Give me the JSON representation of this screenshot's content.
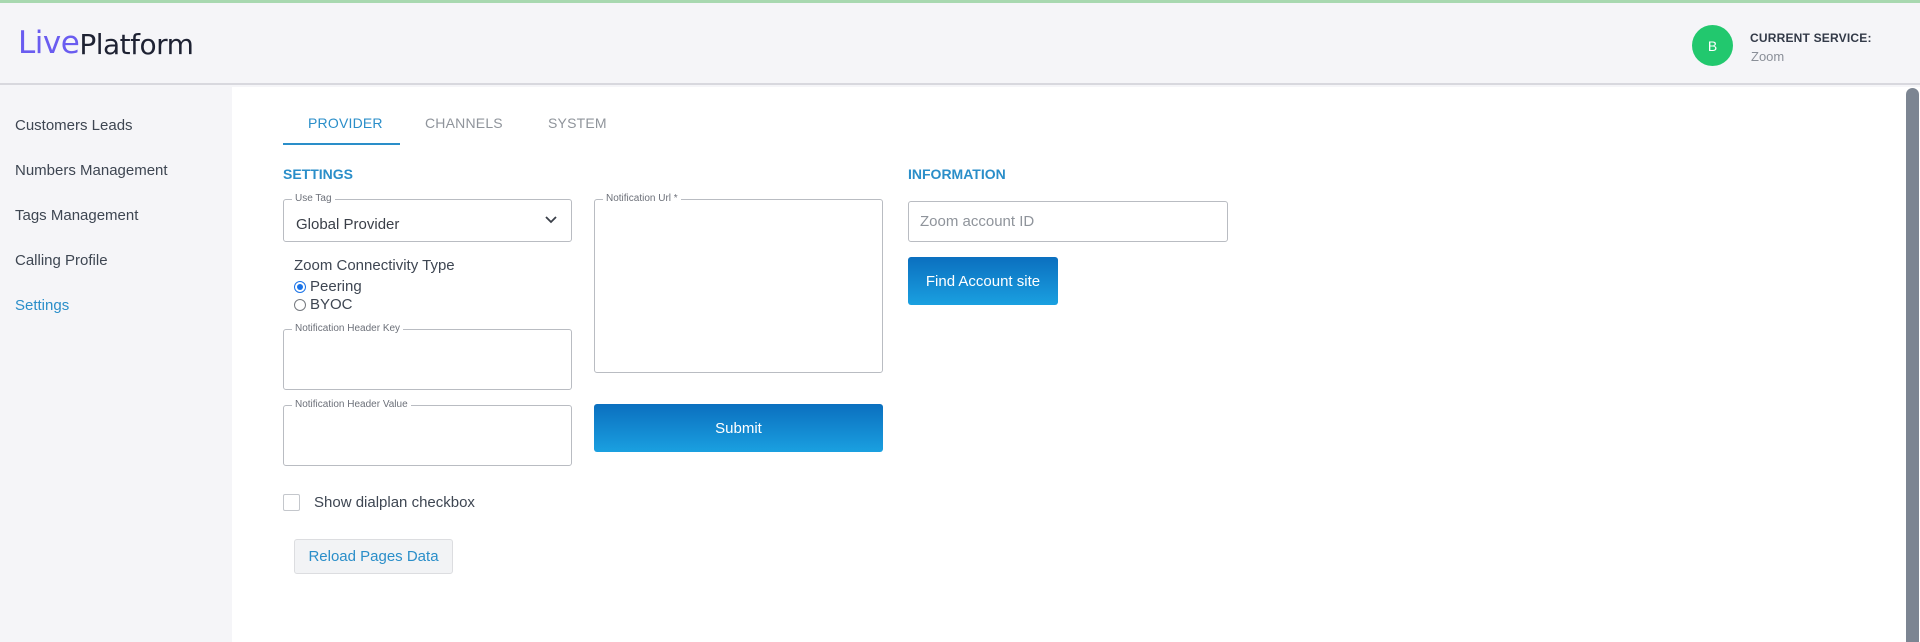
{
  "header": {
    "logo_live": "Live",
    "logo_platform": "Platform",
    "avatar_initial": "B",
    "current_service_label": "CURRENT SERVICE:",
    "current_service_value": "Zoom"
  },
  "sidebar": {
    "items": [
      {
        "label": "Customers Leads",
        "active": false
      },
      {
        "label": "Numbers Management",
        "active": false
      },
      {
        "label": "Tags Management",
        "active": false
      },
      {
        "label": "Calling Profile",
        "active": false
      },
      {
        "label": "Settings",
        "active": true
      }
    ]
  },
  "tabs": [
    {
      "label": "PROVIDER",
      "active": true
    },
    {
      "label": "CHANNELS",
      "active": false
    },
    {
      "label": "SYSTEM",
      "active": false
    }
  ],
  "settings": {
    "title": "SETTINGS",
    "use_tag": {
      "legend": "Use Tag",
      "value": "Global Provider"
    },
    "connectivity": {
      "label": "Zoom Connectivity Type",
      "options": [
        {
          "label": "Peering",
          "checked": true
        },
        {
          "label": "BYOC",
          "checked": false
        }
      ]
    },
    "header_key": {
      "legend": "Notification Header Key",
      "value": ""
    },
    "header_value": {
      "legend": "Notification Header Value",
      "value": ""
    },
    "notification_url": {
      "legend": "Notification Url *",
      "value": ""
    },
    "submit_label": "Submit",
    "dialplan_checkbox": {
      "label": "Show dialplan checkbox",
      "checked": false
    },
    "reload_label": "Reload Pages Data"
  },
  "information": {
    "title": "INFORMATION",
    "zoom_account_placeholder": "Zoom account ID",
    "find_button_label": "Find Account site"
  },
  "colors": {
    "accent": "#2a8ec9",
    "avatar": "#22c86e",
    "button_gradient_start": "#0b6fbf",
    "button_gradient_end": "#1aa0e0"
  }
}
